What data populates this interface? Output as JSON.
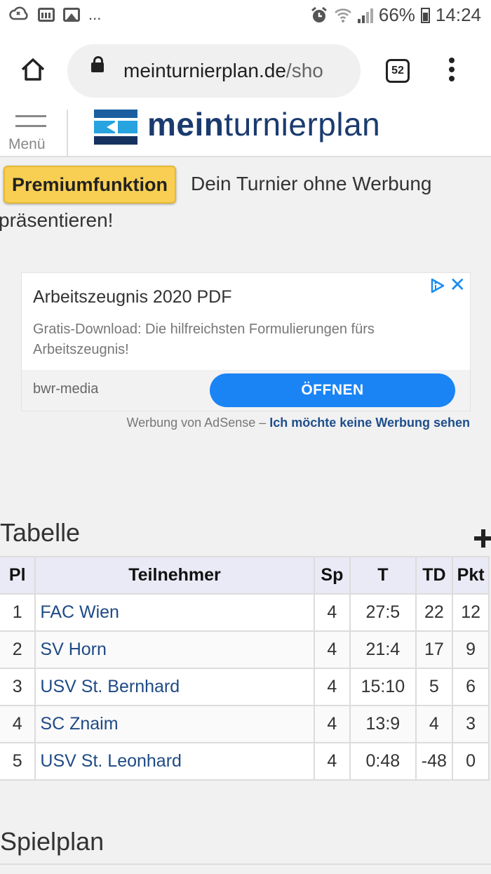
{
  "status_bar": {
    "overflow": "...",
    "battery": "66%",
    "time": "14:24",
    "icons": [
      "cloud-sync-icon",
      "calendar-icon",
      "image-icon",
      "alarm-icon",
      "wifi-icon",
      "signal-icon",
      "battery-icon"
    ]
  },
  "browser": {
    "url_main": "meinturnierplan.de",
    "url_rest": "/sho",
    "tab_count": "52"
  },
  "site": {
    "menu_label": "Menü",
    "brand_bold": "mein",
    "brand_rest": "turnierplan"
  },
  "premium": {
    "button": "Premiumfunktion",
    "text_line1": "Dein Turnier ohne Werbung",
    "text_line2": "präsentieren!"
  },
  "ad": {
    "title": "Arbeitszeugnis 2020 PDF",
    "description": "Gratis-Download: Die hilfreichsten Formulierungen fürs Arbeitszeugnis!",
    "advertiser": "bwr-media",
    "cta": "ÖFFNEN",
    "adsense_label": "Werbung von AdSense –",
    "no_ads_link": "Ich möchte keine Werbung sehen"
  },
  "table": {
    "heading": "Tabelle",
    "headers": [
      "Pl",
      "Teilnehmer",
      "Sp",
      "T",
      "TD",
      "Pkt"
    ],
    "rows": [
      [
        "1",
        "FAC Wien",
        "4",
        "27:5",
        "22",
        "12"
      ],
      [
        "2",
        "SV Horn",
        "4",
        "21:4",
        "17",
        "9"
      ],
      [
        "3",
        "USV St. Bernhard",
        "4",
        "15:10",
        "5",
        "6"
      ],
      [
        "4",
        "SC Znaim",
        "4",
        "13:9",
        "4",
        "3"
      ],
      [
        "5",
        "USV St. Leonhard",
        "4",
        "0:48",
        "-48",
        "0"
      ]
    ]
  },
  "schedule": {
    "heading": "Spielplan"
  },
  "colors": {
    "brand_dark": "#1b3b6f",
    "premium_yellow": "#f8cf53",
    "ad_button": "#1a84f5",
    "team_link": "#1f4a86"
  }
}
